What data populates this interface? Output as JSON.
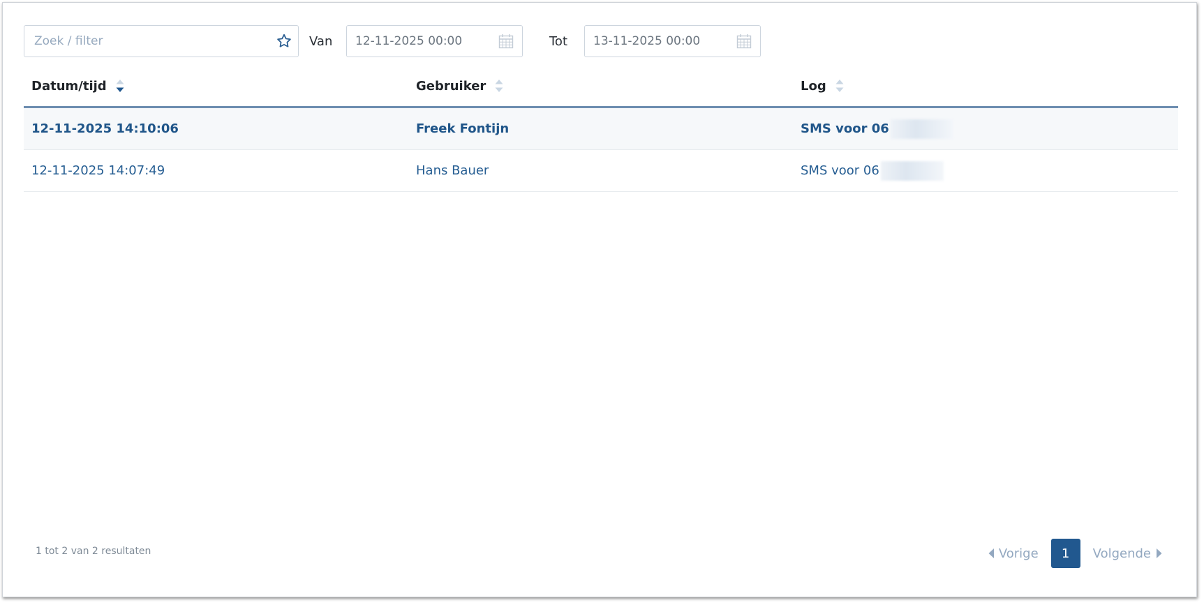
{
  "filters": {
    "search_placeholder": "Zoek / filter",
    "search_value": "",
    "from_label": "Van",
    "from_value": "12-11-2025 00:00",
    "to_label": "Tot",
    "to_value": "13-11-2025 00:00"
  },
  "table": {
    "columns": [
      {
        "label": "Datum/tijd",
        "sort": "descending"
      },
      {
        "label": "Gebruiker",
        "sort": "none"
      },
      {
        "label": "Log",
        "sort": "none"
      }
    ],
    "rows": [
      {
        "datetime": "12-11-2025 14:10:06",
        "user": "Freek Fontijn",
        "log": "SMS voor 06",
        "log_masked": true,
        "active": true
      },
      {
        "datetime": "12-11-2025 14:07:49",
        "user": "Hans Bauer",
        "log": "SMS voor 06",
        "log_masked": true,
        "active": false
      }
    ]
  },
  "footer": {
    "result_info": "1 tot 2 van 2 resultaten",
    "prev_label": "Vorige",
    "current_page": "1",
    "next_label": "Volgende"
  },
  "icons": {
    "search_favorite": "star-outline-icon",
    "date_picker": "calendar-icon",
    "sort": "sort-caret-icon",
    "prev": "caret-left-icon",
    "next": "caret-right-icon"
  },
  "colors": {
    "accent": "#21588f",
    "link": "#255d92",
    "header_rule": "#6d8db0",
    "pager_muted": "#93a8c0"
  }
}
